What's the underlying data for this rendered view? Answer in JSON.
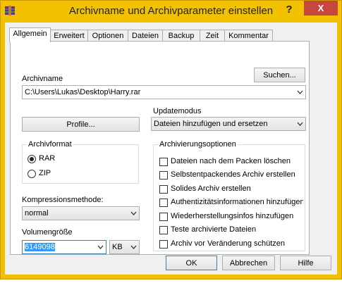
{
  "window": {
    "title": "Archivname und Archivparameter einstellen",
    "help": "?",
    "close": "X"
  },
  "tabs": [
    "Allgemein",
    "Erweitert",
    "Optionen",
    "Dateien",
    "Backup",
    "Zeit",
    "Kommentar"
  ],
  "archive": {
    "label": "Archivname",
    "browse": "Suchen...",
    "value": "C:\\Users\\Lukas\\Desktop\\Harry.rar"
  },
  "update": {
    "label": "Updatemodus",
    "value": "Dateien hinzufügen und ersetzen"
  },
  "profile_button": "Profile...",
  "format": {
    "title": "Archivformat",
    "options": [
      "RAR",
      "ZIP"
    ],
    "selected": "RAR"
  },
  "compression": {
    "label": "Kompressionsmethode:",
    "value": "normal"
  },
  "volume": {
    "label": "Volumengröße",
    "value": "6149098",
    "unit": "KB"
  },
  "options": {
    "title": "Archivierungsoptionen",
    "items": [
      "Dateien nach dem Packen löschen",
      "Selbstentpackendes Archiv erstellen",
      "Solides Archiv erstellen",
      "Authentizitätsinformationen hinzufügen",
      "Wiederherstellungsinfos hinzufügen",
      "Teste archivierte Dateien",
      "Archiv vor Veränderung schützen"
    ]
  },
  "buttons": {
    "ok": "OK",
    "cancel": "Abbrechen",
    "help": "Hilfe"
  },
  "colors": {
    "titlebar": "#f2c200",
    "close": "#c7463e",
    "selection": "#3399ff"
  }
}
